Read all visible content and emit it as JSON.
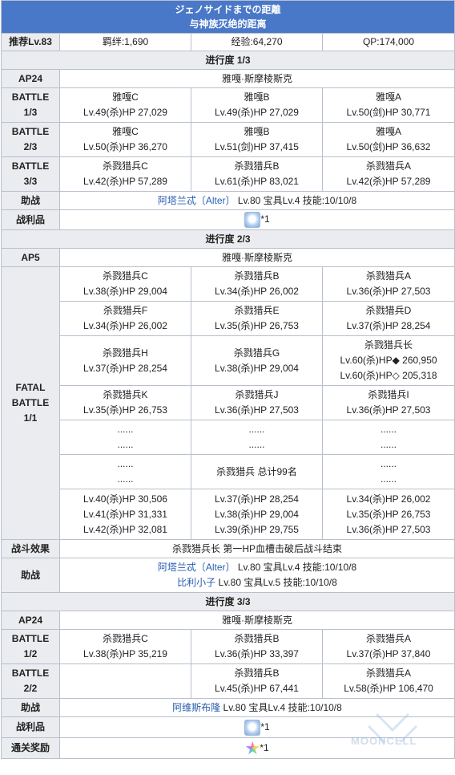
{
  "title": {
    "jp": "ジェノサイドまでの距離",
    "cn": "与神族灭绝的距离"
  },
  "info": {
    "level_label": "推荐Lv.83",
    "bond": "羁绊:1,690",
    "exp": "经验:64,270",
    "qp": "QP:174,000"
  },
  "progress1": {
    "title": "进行度 1/3",
    "ap": "AP24",
    "location": "雅嘎·斯摩棱斯克",
    "battles": [
      {
        "label": "BATTLE\n1/3",
        "enemies": [
          {
            "name": "雅嘎C",
            "stats": "Lv.49(杀)HP 27,029"
          },
          {
            "name": "雅嘎B",
            "stats": "Lv.49(杀)HP 27,029"
          },
          {
            "name": "雅嘎A",
            "stats": "Lv.50(剑)HP 30,771"
          }
        ]
      },
      {
        "label": "BATTLE\n2/3",
        "enemies": [
          {
            "name": "雅嘎C",
            "stats": "Lv.50(杀)HP 36,270"
          },
          {
            "name": "雅嘎B",
            "stats": "Lv.51(剑)HP 37,415"
          },
          {
            "name": "雅嘎A",
            "stats": "Lv.50(剑)HP 36,632"
          }
        ]
      },
      {
        "label": "BATTLE\n3/3",
        "enemies": [
          {
            "name": "杀戮猎兵C",
            "stats": "Lv.42(杀)HP 57,289"
          },
          {
            "name": "杀戮猎兵B",
            "stats": "Lv.61(杀)HP 83,021"
          },
          {
            "name": "杀戮猎兵A",
            "stats": "Lv.42(杀)HP 57,289"
          }
        ]
      }
    ],
    "support_label": "助战",
    "support": {
      "name": "阿塔兰忒〔Alter〕",
      "detail": " Lv.80 宝具Lv.4 技能:10/10/8"
    },
    "drop_label": "战利品",
    "drop_count": "*1"
  },
  "progress2": {
    "title": "进行度 2/3",
    "ap": "AP5",
    "location": "雅嘎·斯摩棱斯克",
    "battle_label": "FATAL\nBATTLE\n1/1",
    "rows": [
      [
        {
          "l1": "杀戮猎兵C",
          "l2": "Lv.38(杀)HP 29,004"
        },
        {
          "l1": "杀戮猎兵B",
          "l2": "Lv.34(杀)HP 26,002"
        },
        {
          "l1": "杀戮猎兵A",
          "l2": "Lv.36(杀)HP 27,503"
        }
      ],
      [
        {
          "l1": "杀戮猎兵F",
          "l2": "Lv.34(杀)HP 26,002"
        },
        {
          "l1": "杀戮猎兵E",
          "l2": "Lv.35(杀)HP 26,753"
        },
        {
          "l1": "杀戮猎兵D",
          "l2": "Lv.37(杀)HP 28,254"
        }
      ],
      [
        {
          "l1": "杀戮猎兵H",
          "l2": "Lv.37(杀)HP 28,254"
        },
        {
          "l1": "杀戮猎兵G",
          "l2": "Lv.38(杀)HP 29,004"
        },
        {
          "l1": "杀戮猎兵长",
          "l2": "Lv.60(杀)HP◆ 260,950",
          "l3": "Lv.60(杀)HP◇ 205,318"
        }
      ],
      [
        {
          "l1": "杀戮猎兵K",
          "l2": "Lv.35(杀)HP 26,753"
        },
        {
          "l1": "杀戮猎兵J",
          "l2": "Lv.36(杀)HP 27,503"
        },
        {
          "l1": "杀戮猎兵I",
          "l2": "Lv.36(杀)HP 27,503"
        }
      ],
      [
        {
          "l1": "......",
          "l2": "......"
        },
        {
          "l1": "......",
          "l2": "......"
        },
        {
          "l1": "......",
          "l2": "......"
        }
      ],
      [
        {
          "l1": "......",
          "l2": "......"
        },
        {
          "l1": "杀戮猎兵 总计99名"
        },
        {
          "l1": "......",
          "l2": "......"
        }
      ],
      [
        {
          "l1": "Lv.40(杀)HP 30,506",
          "l2": "Lv.41(杀)HP 31,331",
          "l3": "Lv.42(杀)HP 32,081"
        },
        {
          "l1": "Lv.37(杀)HP 28,254",
          "l2": "Lv.38(杀)HP 29,004",
          "l3": "Lv.39(杀)HP 29,755"
        },
        {
          "l1": "Lv.34(杀)HP 26,002",
          "l2": "Lv.35(杀)HP 26,753",
          "l3": "Lv.36(杀)HP 27,503"
        }
      ]
    ],
    "effect_label": "战斗效果",
    "effect": "杀戮猎兵长 第一HP血槽击破后战斗结束",
    "support_label": "助战",
    "supports": [
      {
        "name": "阿塔兰忒〔Alter〕",
        "detail": " Lv.80 宝具Lv.4 技能:10/10/8"
      },
      {
        "name": "比利小子",
        "detail": " Lv.80 宝具Lv.5 技能:10/10/8"
      }
    ]
  },
  "progress3": {
    "title": "进行度 3/3",
    "ap": "AP24",
    "location": "雅嘎·斯摩棱斯克",
    "battles": [
      {
        "label": "BATTLE\n1/2",
        "enemies": [
          {
            "name": "杀戮猎兵C",
            "stats": "Lv.38(杀)HP 35,219"
          },
          {
            "name": "杀戮猎兵B",
            "stats": "Lv.36(杀)HP 33,397"
          },
          {
            "name": "杀戮猎兵A",
            "stats": "Lv.37(杀)HP 37,840"
          }
        ]
      },
      {
        "label": "BATTLE\n2/2",
        "enemies": [
          {
            "name": "",
            "stats": ""
          },
          {
            "name": "杀戮猎兵B",
            "stats": "Lv.45(杀)HP 67,441"
          },
          {
            "name": "杀戮猎兵A",
            "stats": "Lv.58(杀)HP 106,470"
          }
        ]
      }
    ],
    "support_label": "助战",
    "support": {
      "name": "阿维斯布隆",
      "detail": " Lv.80 宝具Lv.4 技能:10/10/8"
    },
    "drop_label": "战利品",
    "drop_count": "*1",
    "reward_label": "通关奖励",
    "reward_count": "*1"
  },
  "watermark": "MOONCELL",
  "colors": {
    "header": "#4a78c8",
    "label_bg": "#eaecf0",
    "link": "#2a5db0",
    "border": "#b8c0cc"
  },
  "icons": {
    "drop": "material-item-icon",
    "reward": "saint-quartz-icon"
  }
}
